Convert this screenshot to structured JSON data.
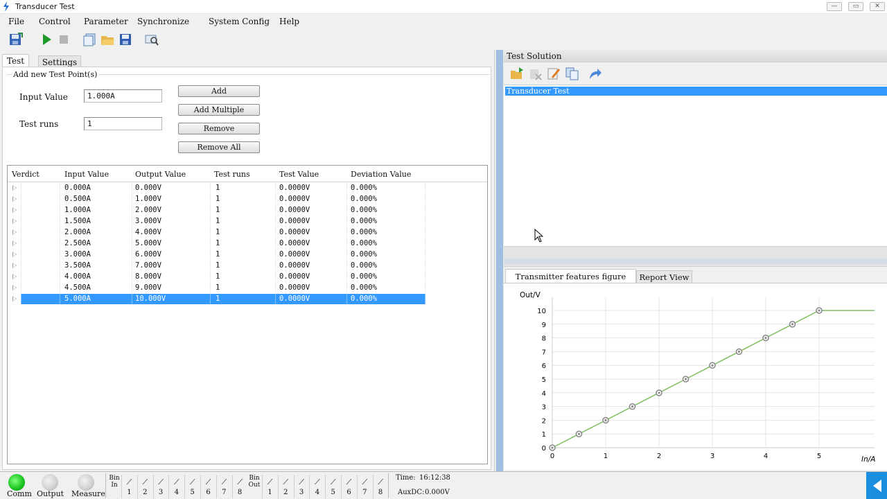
{
  "window": {
    "title": "Transducer Test",
    "min": "—",
    "max": "▭",
    "close": "✕"
  },
  "menu": [
    "File",
    "Control",
    "Parameter",
    "Synchronize",
    "System Config",
    "Help"
  ],
  "tabs": {
    "test": "Test",
    "settings": "Settings"
  },
  "add_group": {
    "title": "Add new Test Point(s)",
    "input_label": "Input Value",
    "input_value": "1.000A",
    "runs_label": "Test runs",
    "runs_value": "1",
    "buttons": {
      "add": "Add",
      "add_multiple": "Add Multiple",
      "remove": "Remove",
      "remove_all": "Remove All"
    }
  },
  "grid": {
    "columns": [
      "Verdict",
      "Input Value",
      "Output Value",
      "Test runs",
      "Test Value",
      "Deviation Value"
    ],
    "rows": [
      {
        "input": "0.000A",
        "output": "0.000V",
        "runs": "1",
        "test": "0.0000V",
        "dev": "0.000%"
      },
      {
        "input": "0.500A",
        "output": "1.000V",
        "runs": "1",
        "test": "0.0000V",
        "dev": "0.000%"
      },
      {
        "input": "1.000A",
        "output": "2.000V",
        "runs": "1",
        "test": "0.0000V",
        "dev": "0.000%"
      },
      {
        "input": "1.500A",
        "output": "3.000V",
        "runs": "1",
        "test": "0.0000V",
        "dev": "0.000%"
      },
      {
        "input": "2.000A",
        "output": "4.000V",
        "runs": "1",
        "test": "0.0000V",
        "dev": "0.000%"
      },
      {
        "input": "2.500A",
        "output": "5.000V",
        "runs": "1",
        "test": "0.0000V",
        "dev": "0.000%"
      },
      {
        "input": "3.000A",
        "output": "6.000V",
        "runs": "1",
        "test": "0.0000V",
        "dev": "0.000%"
      },
      {
        "input": "3.500A",
        "output": "7.000V",
        "runs": "1",
        "test": "0.0000V",
        "dev": "0.000%"
      },
      {
        "input": "4.000A",
        "output": "8.000V",
        "runs": "1",
        "test": "0.0000V",
        "dev": "0.000%"
      },
      {
        "input": "4.500A",
        "output": "9.000V",
        "runs": "1",
        "test": "0.0000V",
        "dev": "0.000%"
      },
      {
        "input": "5.000A",
        "output": "10.000V",
        "runs": "1",
        "test": "0.0000V",
        "dev": "0.000%"
      }
    ],
    "selected_row": 10
  },
  "solution": {
    "title": "Test Solution",
    "tree_node": "Transducer Test"
  },
  "figure_tabs": {
    "features": "Transmitter features figure",
    "report": "Report View"
  },
  "chart_data": {
    "type": "line",
    "ylabel": "Out/V",
    "xlabel": "In/A",
    "xlim": [
      0,
      5
    ],
    "ylim": [
      0,
      10
    ],
    "x_ticks": [
      0,
      1,
      2,
      3,
      4,
      5
    ],
    "y_ticks": [
      0,
      1,
      2,
      3,
      4,
      5,
      6,
      7,
      8,
      9,
      10
    ],
    "grid": true,
    "series_color": "#7fbf5f",
    "marker_color": "#8a8a8a",
    "x": [
      0,
      0.5,
      1,
      1.5,
      2,
      2.5,
      3,
      3.5,
      4,
      4.5,
      5
    ],
    "y": [
      0,
      1,
      2,
      3,
      4,
      5,
      6,
      7,
      8,
      9,
      10
    ],
    "extends_flat_after_last": true
  },
  "status": {
    "comm": "Comm",
    "output": "Output",
    "measure": "Measure",
    "bin_in": "Bin In",
    "bin_out": "Bin Out",
    "bin_in_channels": [
      "1",
      "2",
      "3",
      "4",
      "5",
      "6",
      "7",
      "8"
    ],
    "bin_out_channels": [
      "1",
      "2",
      "3",
      "4",
      "5",
      "6",
      "7",
      "8"
    ],
    "time_label": "Time:",
    "time_value": "16:12:38",
    "auxdc_label": "AuxDC:",
    "auxdc_value": "0.000V"
  },
  "colors": {
    "selection": "#3399ff",
    "led_on": "#22cc22",
    "accent_blue": "#1a8fe0"
  },
  "icons": {
    "toolbar": [
      "save-config-icon",
      "play-icon",
      "stop-icon",
      "new-document-icon",
      "open-folder-icon",
      "save-disk-icon",
      "search-device-icon"
    ],
    "solution_toolbar": [
      "add-node-icon",
      "delete-node-icon",
      "edit-node-icon",
      "copy-node-icon",
      "redo-arrow-icon"
    ]
  }
}
